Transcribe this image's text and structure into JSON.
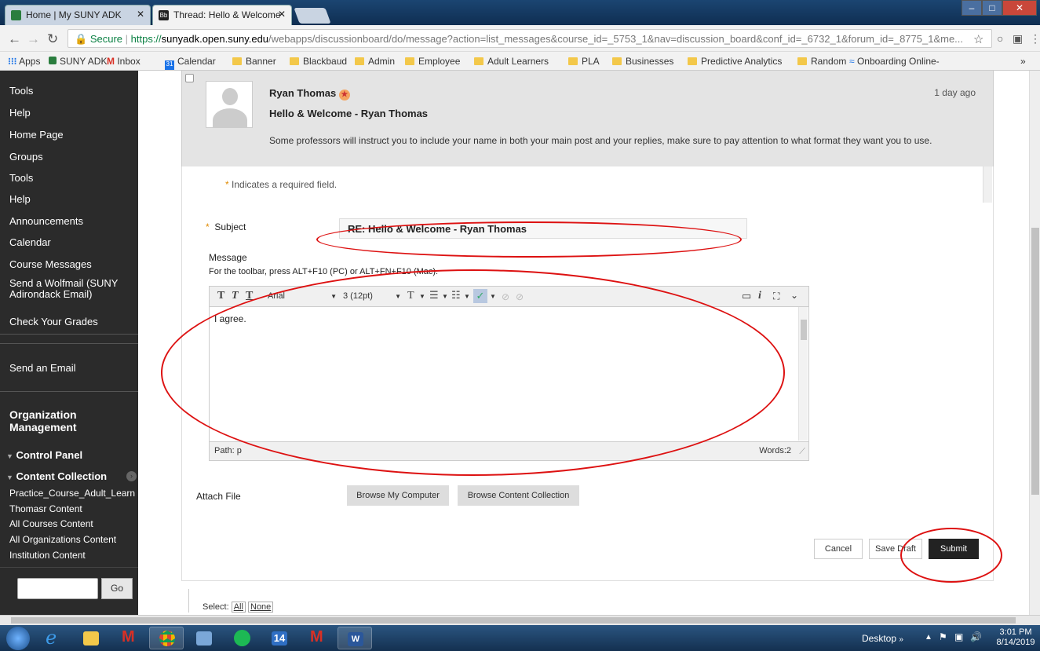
{
  "browser": {
    "tabs": [
      {
        "label": "Home | My SUNY ADK"
      },
      {
        "label": "Thread: Hello & Welcome"
      }
    ],
    "url": {
      "secure_label": "Secure",
      "scheme": "https://",
      "host": "sunyadk.open.suny.edu",
      "path": "/webapps/discussionboard/do/message?action=list_messages&course_id=_5753_1&nav=discussion_board&conf_id=_6732_1&forum_id=_8775_1&me..."
    },
    "bookmarks": [
      "Apps",
      "SUNY ADK",
      "Inbox",
      "Calendar",
      "Banner",
      "Blackbaud",
      "Admin",
      "Employee",
      "Adult Learners",
      "PLA",
      "Businesses",
      "Predictive Analytics",
      "Random",
      "Onboarding Online-"
    ],
    "bookmarks_more": "»"
  },
  "sidebar": {
    "items": [
      "Tools",
      "Help",
      "Home Page",
      "Groups",
      "Tools",
      "Help",
      "Announcements",
      "Calendar",
      "Course Messages",
      "Send a Wolfmail (SUNY Adirondack Email)",
      "Check Your Grades",
      "Send an Email"
    ],
    "org_heading": "Organization Management",
    "control_panel": "Control Panel",
    "content_collection": "Content Collection",
    "collection_items": [
      "Practice_Course_Adult_Learn",
      "Thomasr Content",
      "All Courses Content",
      "All Organizations Content",
      "Institution Content"
    ],
    "go_label": "Go",
    "search_value": ""
  },
  "post": {
    "author": "Ryan Thomas",
    "title": "Hello & Welcome - Ryan Thomas",
    "body": "Some professors will instruct you to include your name in both your main post and your replies, make sure to pay attention to what format they want you to use.",
    "time": "1 day ago"
  },
  "form": {
    "required_note": "Indicates a required field.",
    "subject_label": "Subject",
    "subject_value": "RE: Hello & Welcome - Ryan Thomas",
    "message_label": "Message",
    "toolbar_hint": "For the toolbar, press ALT+F10 (PC) or ALT+FN+F10 (Mac).",
    "font_name": "Arial",
    "font_size": "3 (12pt)",
    "message_text": "I agree.",
    "path": "Path: p",
    "words": "Words:2",
    "attach_label": "Attach File",
    "browse_computer": "Browse My Computer",
    "browse_collection": "Browse Content Collection",
    "cancel": "Cancel",
    "save_draft": "Save Draft",
    "submit": "Submit"
  },
  "select": {
    "label": "Select:",
    "all": "All",
    "none": "None"
  },
  "taskbar": {
    "desktop": "Desktop",
    "time": "3:01 PM",
    "date": "8/14/2019",
    "calendar_day": "14"
  },
  "colors": {
    "sidebar_bg": "#2b2b2b",
    "submit_bg": "#222222",
    "annotation": "#dd1111",
    "required": "#e08a00"
  }
}
